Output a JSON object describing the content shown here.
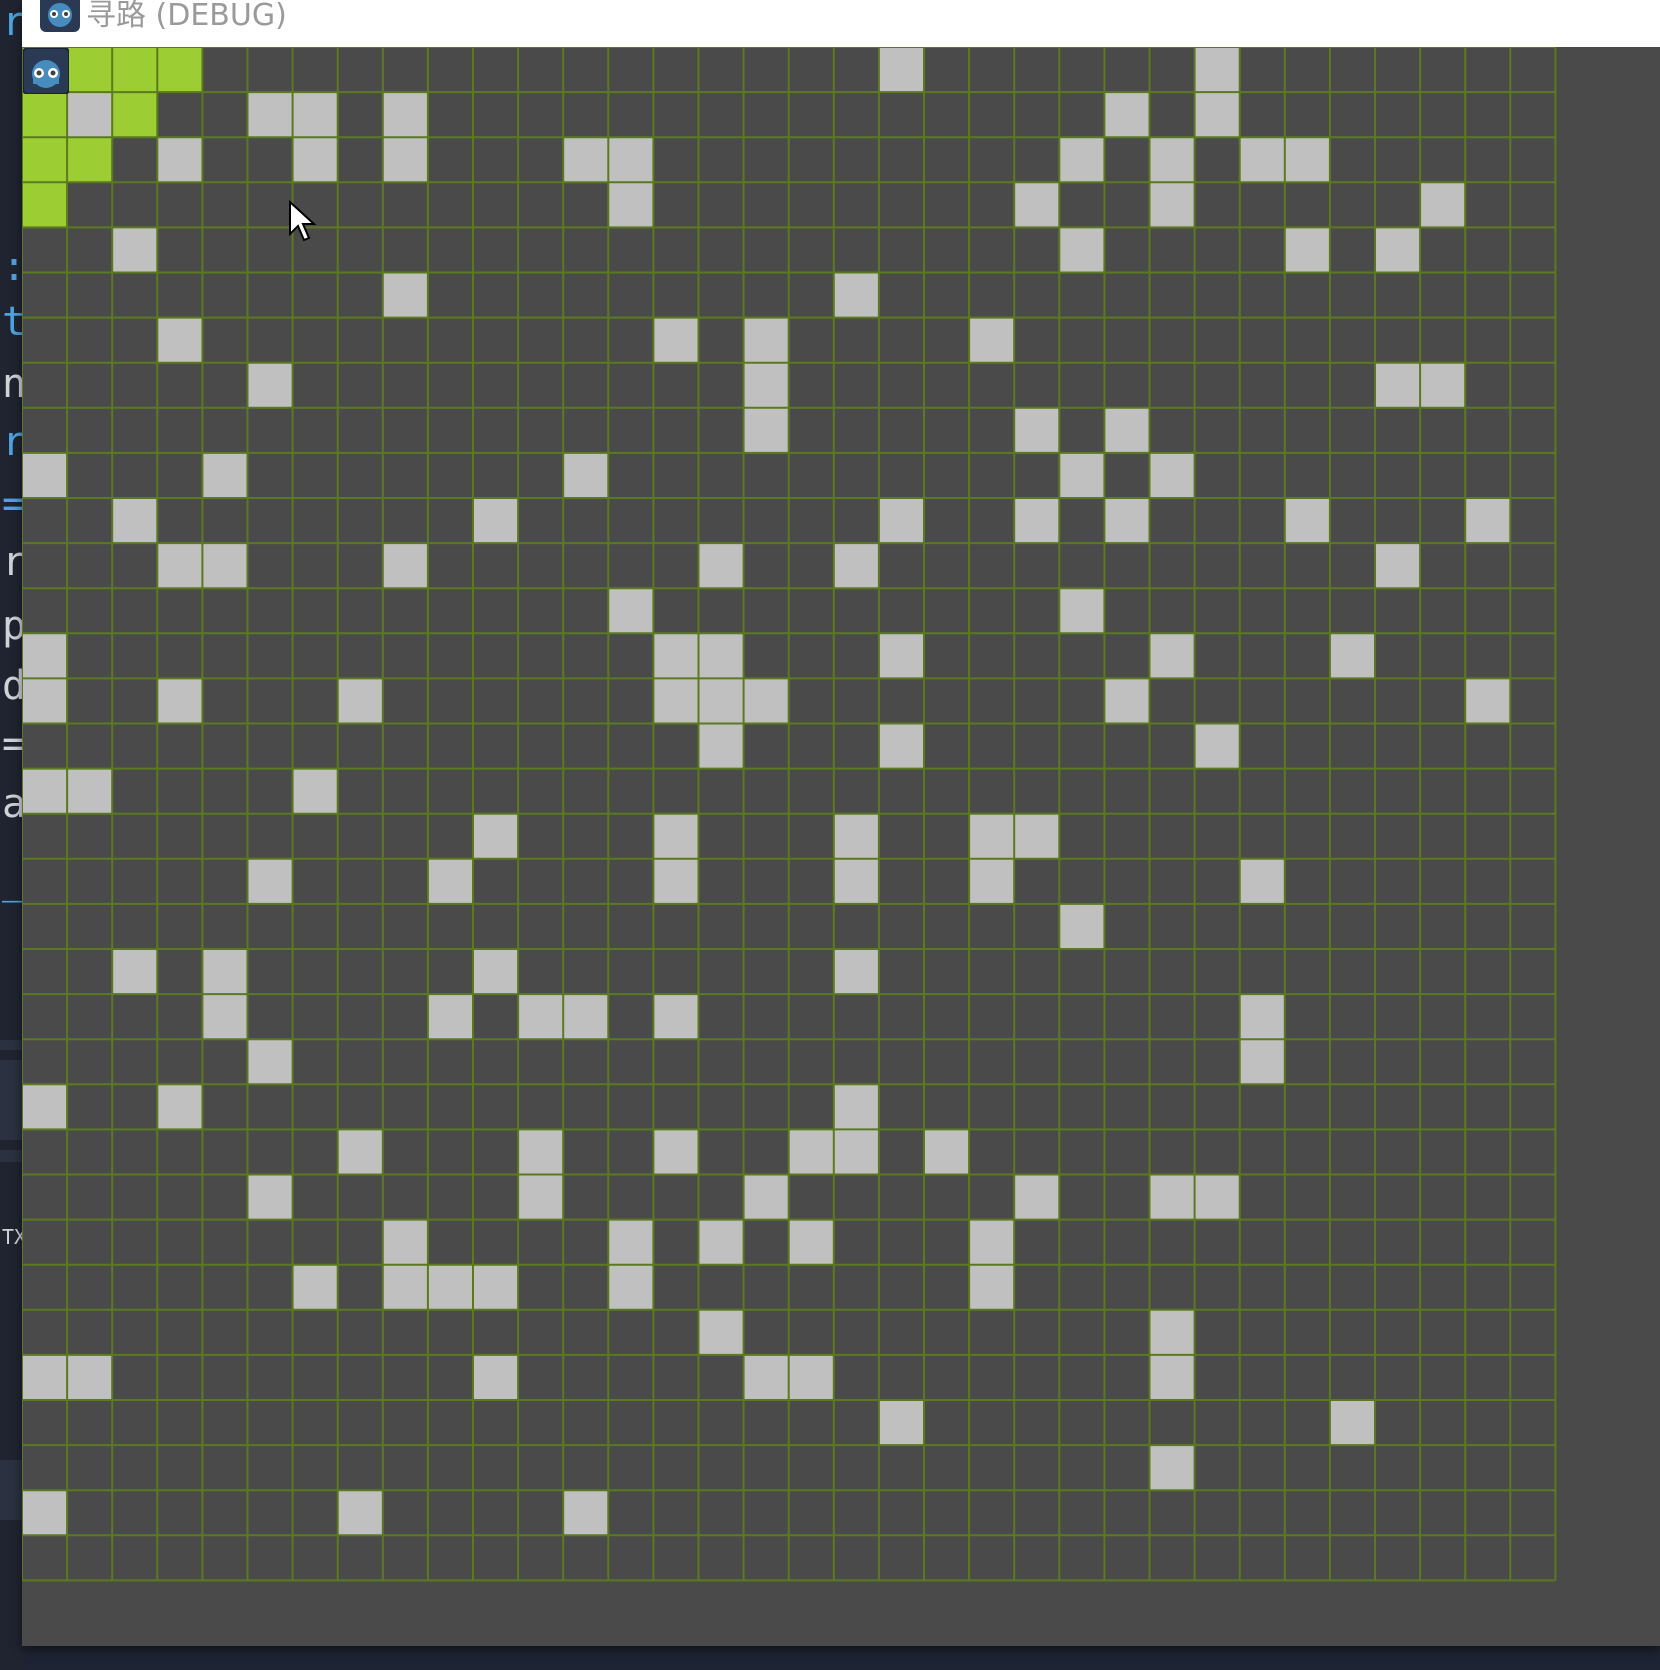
{
  "window": {
    "title": "寻路 (DEBUG)",
    "title_icon": "godot-icon"
  },
  "viewport": {
    "app_icon": "godot-icon"
  },
  "editor_behind": {
    "chars": [
      "r",
      ":",
      "t",
      "n",
      "r",
      "=",
      "r",
      "p",
      "d",
      "=",
      "a",
      "_",
      "TX"
    ],
    "color_keyword": "#4fa3e0",
    "color_text": "#cfd3da"
  },
  "grid_map": {
    "cols": 34,
    "rows": 34,
    "colors": {
      "floor": "#4a4a4a",
      "wall": "#c0c0c0",
      "gridline": "#5b7a1f",
      "highlight": "#9ccd32"
    },
    "walls": [
      [
        0,
        19
      ],
      [
        0,
        26
      ],
      [
        1,
        1
      ],
      [
        1,
        5
      ],
      [
        1,
        6
      ],
      [
        1,
        8
      ],
      [
        1,
        24
      ],
      [
        1,
        26
      ],
      [
        2,
        3
      ],
      [
        2,
        6
      ],
      [
        2,
        8
      ],
      [
        2,
        12
      ],
      [
        2,
        13
      ],
      [
        2,
        23
      ],
      [
        2,
        25
      ],
      [
        2,
        27
      ],
      [
        2,
        28
      ],
      [
        3,
        13
      ],
      [
        3,
        22
      ],
      [
        3,
        25
      ],
      [
        3,
        31
      ],
      [
        4,
        2
      ],
      [
        4,
        23
      ],
      [
        4,
        28
      ],
      [
        4,
        30
      ],
      [
        5,
        8
      ],
      [
        5,
        18
      ],
      [
        6,
        3
      ],
      [
        6,
        14
      ],
      [
        6,
        16
      ],
      [
        6,
        21
      ],
      [
        7,
        5
      ],
      [
        7,
        16
      ],
      [
        7,
        30
      ],
      [
        7,
        31
      ],
      [
        8,
        16
      ],
      [
        8,
        22
      ],
      [
        8,
        24
      ],
      [
        9,
        0
      ],
      [
        9,
        4
      ],
      [
        9,
        12
      ],
      [
        9,
        23
      ],
      [
        9,
        25
      ],
      [
        10,
        2
      ],
      [
        10,
        10
      ],
      [
        10,
        19
      ],
      [
        10,
        22
      ],
      [
        10,
        24
      ],
      [
        10,
        28
      ],
      [
        10,
        32
      ],
      [
        11,
        3
      ],
      [
        11,
        4
      ],
      [
        11,
        8
      ],
      [
        11,
        15
      ],
      [
        11,
        18
      ],
      [
        11,
        30
      ],
      [
        12,
        13
      ],
      [
        12,
        23
      ],
      [
        13,
        0
      ],
      [
        13,
        14
      ],
      [
        13,
        15
      ],
      [
        13,
        19
      ],
      [
        13,
        25
      ],
      [
        13,
        29
      ],
      [
        14,
        0
      ],
      [
        14,
        3
      ],
      [
        14,
        7
      ],
      [
        14,
        14
      ],
      [
        14,
        15
      ],
      [
        14,
        16
      ],
      [
        14,
        24
      ],
      [
        14,
        32
      ],
      [
        15,
        15
      ],
      [
        15,
        19
      ],
      [
        15,
        26
      ],
      [
        16,
        0
      ],
      [
        16,
        1
      ],
      [
        16,
        6
      ],
      [
        17,
        10
      ],
      [
        17,
        14
      ],
      [
        17,
        18
      ],
      [
        17,
        21
      ],
      [
        17,
        22
      ],
      [
        18,
        5
      ],
      [
        18,
        9
      ],
      [
        18,
        14
      ],
      [
        18,
        18
      ],
      [
        18,
        21
      ],
      [
        18,
        27
      ],
      [
        19,
        23
      ],
      [
        20,
        2
      ],
      [
        20,
        4
      ],
      [
        20,
        10
      ],
      [
        20,
        18
      ],
      [
        21,
        4
      ],
      [
        21,
        9
      ],
      [
        21,
        11
      ],
      [
        21,
        12
      ],
      [
        21,
        14
      ],
      [
        21,
        27
      ],
      [
        22,
        5
      ],
      [
        22,
        27
      ],
      [
        23,
        0
      ],
      [
        23,
        3
      ],
      [
        23,
        18
      ],
      [
        24,
        7
      ],
      [
        24,
        11
      ],
      [
        24,
        14
      ],
      [
        24,
        17
      ],
      [
        24,
        18
      ],
      [
        24,
        20
      ],
      [
        25,
        5
      ],
      [
        25,
        11
      ],
      [
        25,
        16
      ],
      [
        25,
        22
      ],
      [
        25,
        25
      ],
      [
        25,
        26
      ],
      [
        26,
        8
      ],
      [
        26,
        13
      ],
      [
        26,
        15
      ],
      [
        26,
        17
      ],
      [
        26,
        21
      ],
      [
        27,
        6
      ],
      [
        27,
        8
      ],
      [
        27,
        9
      ],
      [
        27,
        10
      ],
      [
        27,
        13
      ],
      [
        27,
        21
      ],
      [
        28,
        15
      ],
      [
        28,
        25
      ],
      [
        29,
        0
      ],
      [
        29,
        1
      ],
      [
        29,
        10
      ],
      [
        29,
        16
      ],
      [
        29,
        17
      ],
      [
        29,
        25
      ],
      [
        30,
        19
      ],
      [
        30,
        29
      ],
      [
        31,
        25
      ],
      [
        32,
        0
      ],
      [
        32,
        7
      ],
      [
        32,
        12
      ]
    ],
    "highlight_cells": [
      [
        0,
        0
      ],
      [
        0,
        1
      ],
      [
        0,
        2
      ],
      [
        0,
        3
      ],
      [
        1,
        0
      ],
      [
        1,
        2
      ],
      [
        2,
        0
      ],
      [
        2,
        1
      ],
      [
        3,
        0
      ]
    ]
  }
}
